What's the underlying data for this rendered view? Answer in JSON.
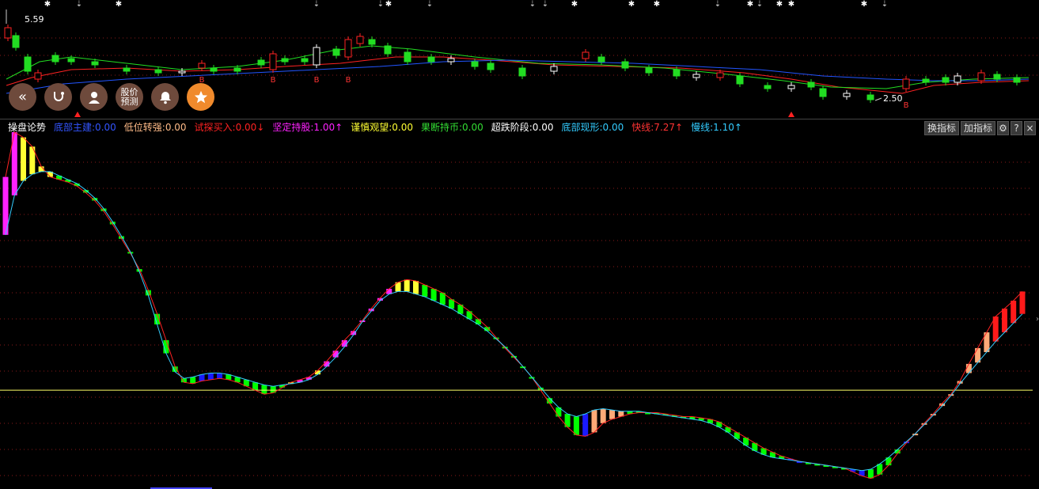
{
  "kline": {
    "price_high_label": "5.59",
    "price_low_label": "2.50",
    "signal_mark": "B"
  },
  "toolbar": {
    "buttons": [
      {
        "name": "collapse-button",
        "label": "«"
      },
      {
        "name": "stethoscope-button",
        "label": "",
        "icon": "stethoscope-icon"
      },
      {
        "name": "advisor-button",
        "label": "",
        "icon": "person-icon"
      },
      {
        "name": "price-forecast-button",
        "label_line1": "股价",
        "label_line2": "预测"
      },
      {
        "name": "alert-button",
        "label": "",
        "icon": "bell-icon"
      },
      {
        "name": "favorite-button",
        "label": "",
        "icon": "star-icon"
      }
    ]
  },
  "indicator_legend": {
    "title": "操盘论势",
    "items": [
      {
        "label": "底部主建:0.00",
        "color": "#3355ff"
      },
      {
        "label": "低位转强:0.00",
        "color": "#ffbb88"
      },
      {
        "label": "试探买入:0.00↓",
        "color": "#ff2222"
      },
      {
        "label": "坚定持股:1.00↑",
        "color": "#ff22ff"
      },
      {
        "label": "谨慎观望:0.00",
        "color": "#ffff33"
      },
      {
        "label": "果断持币:0.00",
        "color": "#33dd33"
      },
      {
        "label": "超跌阶段:0.00",
        "color": "#ffffff"
      },
      {
        "label": "底部现形:0.00",
        "color": "#33ccff"
      },
      {
        "label": "快线:7.27↑",
        "color": "#ff3333"
      },
      {
        "label": "慢线:1.10↑",
        "color": "#33ccff"
      }
    ]
  },
  "panel_tools": {
    "switch_label": "换指标",
    "add_label": "加指标",
    "gear": "⚙",
    "help": "?",
    "close": "×"
  },
  "chart_data": {
    "type": "bar",
    "colors": {
      "magenta": "#ff22ff",
      "yellow": "#ffff33",
      "green": "#00ff00",
      "blue": "#1a1aff",
      "peach": "#ffaa77",
      "red": "#ff1a1a",
      "slow_line": "#33ccff",
      "fast_line": "#ff2222",
      "baseline": "#ffff66"
    },
    "series": [
      {
        "name": "快线",
        "values": [
          0.62,
          0.96,
          0.92,
          0.85,
          0.7,
          0.62,
          0.6,
          0.58,
          0.55,
          0.5,
          0.44,
          0.36,
          0.26,
          0.15,
          0.04,
          -0.08,
          -0.24,
          -0.42,
          -0.62,
          -0.82,
          -0.94,
          -0.95,
          -0.93,
          -0.92,
          -0.91,
          -0.92,
          -0.94,
          -0.97,
          -1.0,
          -1.03,
          -1.02,
          -0.98,
          -0.94,
          -0.92,
          -0.9,
          -0.85,
          -0.78,
          -0.7,
          -0.62,
          -0.55,
          -0.47,
          -0.38,
          -0.3,
          -0.23,
          -0.18,
          -0.16,
          -0.17,
          -0.2,
          -0.23,
          -0.26,
          -0.31,
          -0.35,
          -0.4,
          -0.46,
          -0.52,
          -0.6,
          -0.68,
          -0.75,
          -0.82,
          -0.9,
          -1.0,
          -1.1,
          -1.2,
          -1.28,
          -1.34,
          -1.35,
          -1.32,
          -1.25,
          -1.22,
          -1.2,
          -1.18,
          -1.17,
          -1.17,
          -1.17,
          -1.18,
          -1.19,
          -1.2,
          -1.2,
          -1.21,
          -1.22,
          -1.24,
          -1.28,
          -1.32,
          -1.36,
          -1.4,
          -1.44,
          -1.47,
          -1.5,
          -1.52,
          -1.54,
          -1.55,
          -1.56,
          -1.57,
          -1.58,
          -1.59,
          -1.62,
          -1.65,
          -1.67,
          -1.64,
          -1.57,
          -1.48,
          -1.4,
          -1.33,
          -1.25,
          -1.18,
          -1.1,
          -1.03,
          -0.93,
          -0.8,
          -0.68,
          -0.56,
          -0.44,
          -0.38,
          -0.32,
          -0.25
        ]
      },
      {
        "name": "慢线",
        "values": [
          0.18,
          0.48,
          0.59,
          0.64,
          0.66,
          0.66,
          0.63,
          0.6,
          0.57,
          0.52,
          0.46,
          0.38,
          0.28,
          0.17,
          0.05,
          -0.1,
          -0.28,
          -0.5,
          -0.72,
          -0.86,
          -0.91,
          -0.9,
          -0.88,
          -0.87,
          -0.87,
          -0.88,
          -0.9,
          -0.92,
          -0.94,
          -0.96,
          -0.97,
          -0.96,
          -0.95,
          -0.94,
          -0.92,
          -0.88,
          -0.82,
          -0.75,
          -0.67,
          -0.58,
          -0.48,
          -0.4,
          -0.32,
          -0.27,
          -0.25,
          -0.25,
          -0.27,
          -0.29,
          -0.32,
          -0.35,
          -0.38,
          -0.42,
          -0.46,
          -0.5,
          -0.55,
          -0.61,
          -0.67,
          -0.74,
          -0.82,
          -0.9,
          -0.98,
          -1.06,
          -1.13,
          -1.18,
          -1.2,
          -1.18,
          -1.15,
          -1.14,
          -1.15,
          -1.16,
          -1.16,
          -1.16,
          -1.17,
          -1.18,
          -1.19,
          -1.2,
          -1.21,
          -1.22,
          -1.23,
          -1.25,
          -1.28,
          -1.32,
          -1.37,
          -1.42,
          -1.46,
          -1.49,
          -1.51,
          -1.52,
          -1.53,
          -1.54,
          -1.55,
          -1.56,
          -1.57,
          -1.58,
          -1.59,
          -1.6,
          -1.61,
          -1.6,
          -1.56,
          -1.51,
          -1.45,
          -1.39,
          -1.33,
          -1.26,
          -1.19,
          -1.12,
          -1.04,
          -0.95,
          -0.87,
          -0.79,
          -0.71,
          -0.63,
          -0.56,
          -0.49,
          -0.42
        ]
      }
    ],
    "bar_color_codes": [
      "magenta",
      "magenta",
      "yellow",
      "yellow",
      "yellow",
      "yellow",
      "green",
      "green",
      "green",
      "green",
      "green",
      "green",
      "green",
      "green",
      "green",
      "green",
      "green",
      "green",
      "green",
      "green",
      "green",
      "green",
      "blue",
      "blue",
      "blue",
      "green",
      "green",
      "green",
      "green",
      "green",
      "green",
      "green",
      "yellow",
      "magenta",
      "magenta",
      "yellow",
      "magenta",
      "magenta",
      "magenta",
      "magenta",
      "magenta",
      "magenta",
      "magenta",
      "magenta",
      "yellow",
      "yellow",
      "yellow",
      "green",
      "green",
      "green",
      "green",
      "green",
      "green",
      "green",
      "green",
      "green",
      "green",
      "green",
      "green",
      "green",
      "green",
      "green",
      "green",
      "green",
      "green",
      "blue",
      "peach",
      "peach",
      "peach",
      "peach",
      "green",
      "green",
      "green",
      "green",
      "green",
      "green",
      "green",
      "green",
      "green",
      "green",
      "green",
      "green",
      "green",
      "green",
      "green",
      "green",
      "green",
      "green",
      "blue",
      "blue",
      "green",
      "green",
      "green",
      "green",
      "green",
      "blue",
      "blue",
      "green",
      "green",
      "green",
      "green",
      "blue",
      "peach",
      "peach",
      "peach",
      "peach",
      "peach",
      "peach",
      "peach",
      "peach",
      "peach",
      "red",
      "red",
      "red",
      "red",
      "red",
      "magenta",
      "magenta"
    ],
    "baseline_value": -1.0,
    "ylim": [
      -1.75,
      1.05
    ],
    "grid": "dotted horizontal"
  }
}
